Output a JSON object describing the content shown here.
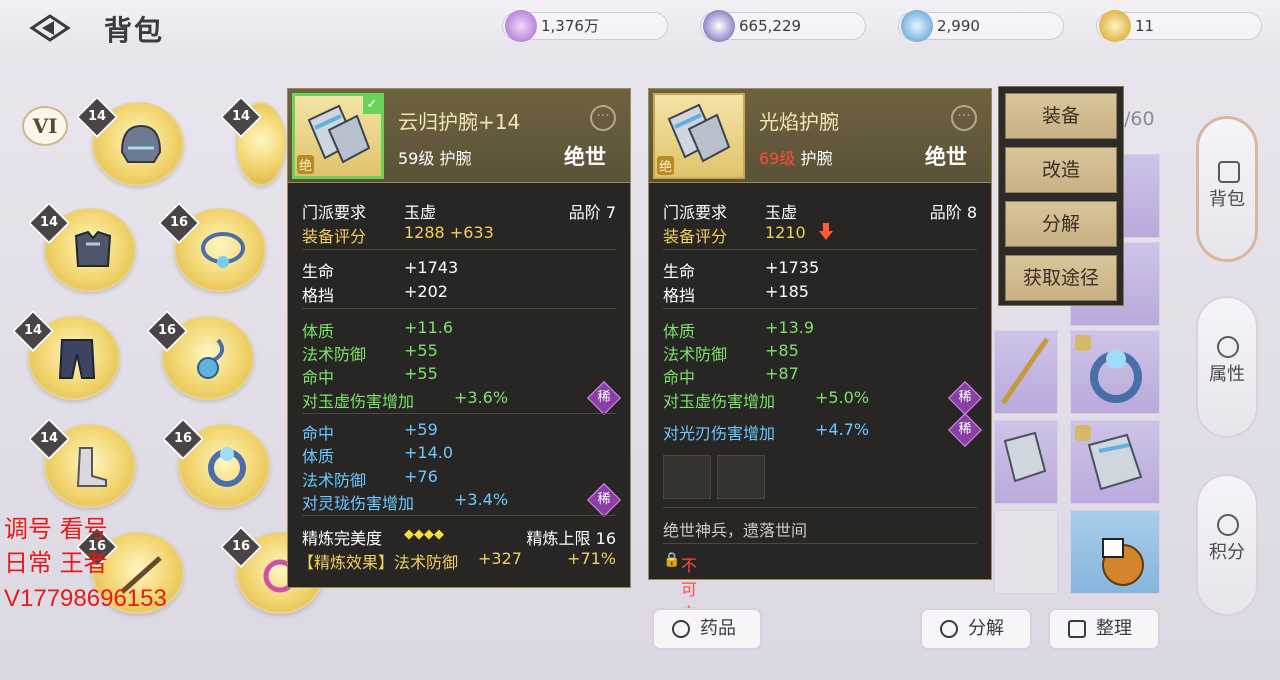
{
  "header": {
    "title": "背包"
  },
  "currencies": [
    {
      "value": "1,376万",
      "icon": "card-currency-icon",
      "color": "#b787d8"
    },
    {
      "value": "665,229",
      "icon": "silver-coin-icon",
      "color": "#8f88c6"
    },
    {
      "value": "2,990",
      "icon": "jade-coin-icon",
      "color": "#7ab2df"
    },
    {
      "value": "11",
      "icon": "gold-coin-icon",
      "color": "#e2b64a"
    }
  ],
  "equipment": {
    "tier": "VI",
    "slots": [
      {
        "level": "14"
      },
      {
        "level": "14"
      },
      {
        "level": "14"
      },
      {
        "level": "16"
      },
      {
        "level": "14"
      },
      {
        "level": "16"
      },
      {
        "level": "14"
      },
      {
        "level": "16"
      },
      {
        "level": "16"
      },
      {
        "level": "16"
      }
    ]
  },
  "equipped_item": {
    "name": "云归护腕+14",
    "badge": "绝",
    "level": "59级",
    "type": "护腕",
    "quality": "绝世",
    "sect_label": "门派要求",
    "sect": "玉虚",
    "grade_label": "品阶",
    "grade": "7",
    "score_label": "装备评分",
    "score": "1288 +633",
    "base_stats": [
      {
        "k": "生命",
        "v": "+1743"
      },
      {
        "k": "格挡",
        "v": "+202"
      }
    ],
    "green_stats": [
      {
        "k": "体质",
        "v": "+11.6"
      },
      {
        "k": "法术防御",
        "v": "+55"
      },
      {
        "k": "命中",
        "v": "+55"
      },
      {
        "k": "对玉虚伤害增加",
        "v": "+3.6%"
      }
    ],
    "blue_stats": [
      {
        "k": "命中",
        "v": "+59"
      },
      {
        "k": "体质",
        "v": "+14.0"
      },
      {
        "k": "法术防御",
        "v": "+76"
      },
      {
        "k": "对灵珑伤害增加",
        "v": "+3.4%"
      }
    ],
    "rare_label": "稀",
    "refine_label": "精炼完美度",
    "refine_stars": "◆◆◆◆",
    "refine_cap": "精炼上限 16",
    "refine_effect_label": "【精炼效果】法术防御",
    "refine_effect_value": "+327",
    "refine_effect_pct": "+71%"
  },
  "compare_item": {
    "name": "光焰护腕",
    "badge": "绝",
    "level": "69级",
    "type": "护腕",
    "quality": "绝世",
    "sect_label": "门派要求",
    "sect": "玉虚",
    "grade_label": "品阶",
    "grade": "8",
    "score_label": "装备评分",
    "score": "1210",
    "base_stats": [
      {
        "k": "生命",
        "v": "+1735"
      },
      {
        "k": "格挡",
        "v": "+185"
      }
    ],
    "green_stats": [
      {
        "k": "体质",
        "v": "+13.9"
      },
      {
        "k": "法术防御",
        "v": "+85"
      },
      {
        "k": "命中",
        "v": "+87"
      },
      {
        "k": "对玉虚伤害增加",
        "v": "+5.0%"
      }
    ],
    "blue_stats": [
      {
        "k": "对光刃伤害增加",
        "v": "+4.7%"
      }
    ],
    "rare_label": "稀",
    "description": "绝世神兵，遗落世间",
    "trade_status": "不可交易"
  },
  "actions": {
    "equip": "装备",
    "modify": "改造",
    "decompose": "分解",
    "obtain": "获取途径"
  },
  "bag": {
    "count": "/60"
  },
  "side_tabs": [
    {
      "label": "背包"
    },
    {
      "label": "属性"
    },
    {
      "label": "积分"
    }
  ],
  "bottom": {
    "medicine": "药品",
    "decompose": "分解",
    "arrange": "整理"
  },
  "watermark": {
    "line1": "调号 看号",
    "line2": "日常 王者",
    "line3": "V17798696153"
  }
}
